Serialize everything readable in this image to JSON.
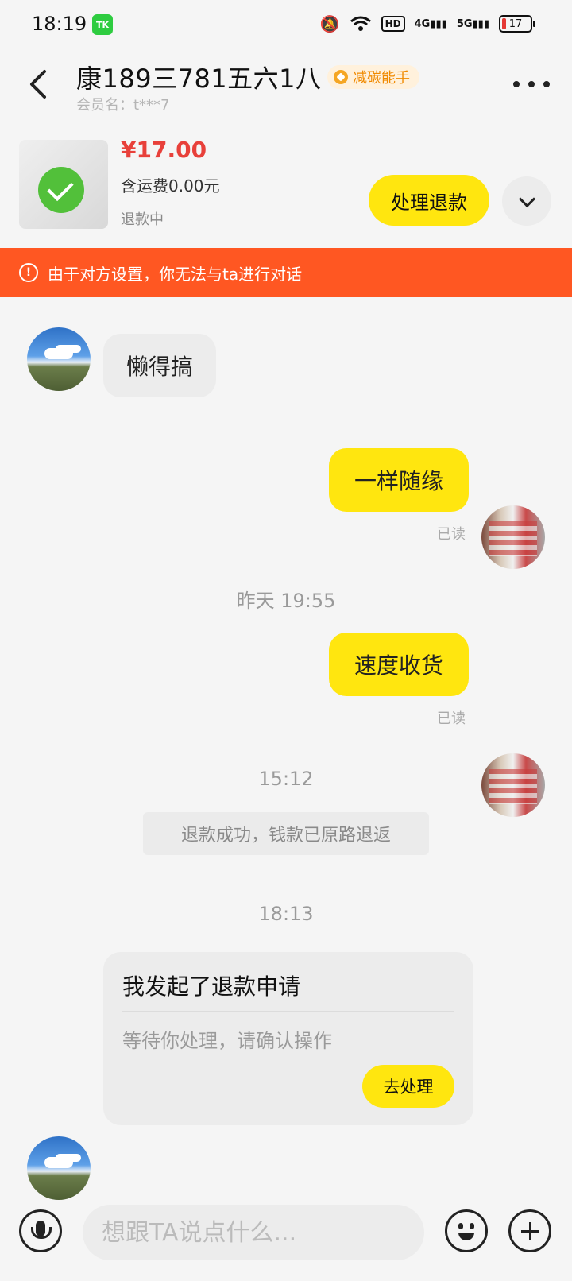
{
  "status_bar": {
    "time": "18:19",
    "app_badge": "TK",
    "hd_label": "HD",
    "signal_4g": "4G",
    "signal_5g": "5G",
    "battery": "17"
  },
  "header": {
    "title": "康189三781五六1八",
    "tag": "减碳能手",
    "member": "会员名：t***7"
  },
  "order": {
    "price": "¥17.00",
    "shipping": "含运费0.00元",
    "status": "退款中",
    "action_label": "处理退款"
  },
  "warning": {
    "text": "由于对方设置，你无法与ta进行对话"
  },
  "messages": {
    "m1": "懒得搞",
    "m2": "一样随缘",
    "m2_read": "已读",
    "ts1": "昨天 19:55",
    "m3": "速度收货",
    "m3_read": "已读",
    "ts2": "15:12",
    "system": "退款成功，钱款已原路退返",
    "ts3": "18:13",
    "card_title": "我发起了退款申请",
    "card_sub": "等待你处理，请确认操作",
    "card_button": "去处理"
  },
  "input": {
    "placeholder": "想跟TA说点什么..."
  },
  "colors": {
    "accent_yellow": "#ffe60f",
    "warning_bg": "#ff5722",
    "price_red": "#e8403a"
  }
}
